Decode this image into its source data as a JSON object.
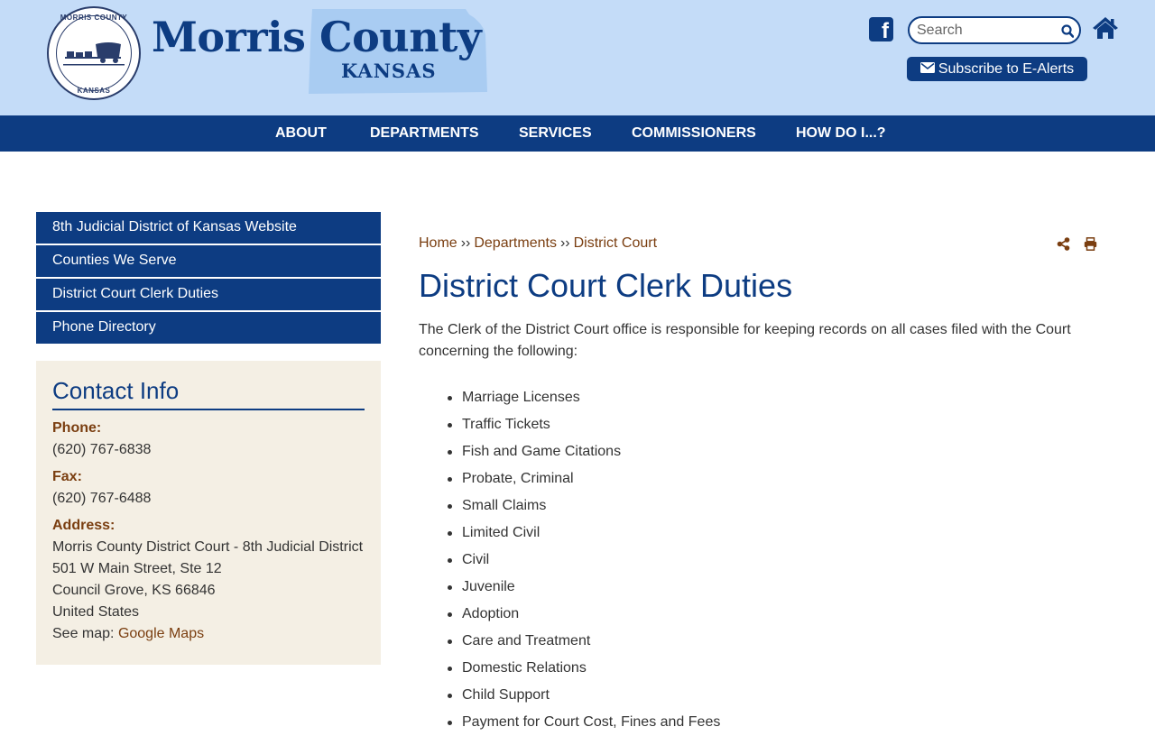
{
  "header": {
    "seal_top_text": "MORRIS COUNTY",
    "seal_bottom_text": "KANSAS",
    "title": "Morris County",
    "subtitle": "KANSAS",
    "search_placeholder": "Search",
    "subscribe_label": "Subscribe to E-Alerts",
    "facebook_glyph": "f"
  },
  "nav": {
    "items": [
      "ABOUT",
      "DEPARTMENTS",
      "SERVICES",
      "COMMISSIONERS",
      "HOW DO I...?"
    ]
  },
  "sidebar": {
    "links": [
      "8th Judicial District of Kansas Website",
      "Counties We Serve",
      "District Court Clerk Duties",
      "Phone Directory"
    ]
  },
  "contact": {
    "heading": "Contact Info",
    "phone_label": "Phone:",
    "phone": "(620) 767-6838",
    "fax_label": "Fax:",
    "fax": "(620) 767-6488",
    "address_label": "Address:",
    "address_lines": [
      "Morris County District Court - 8th Judicial District",
      "501 W Main Street, Ste 12",
      "Council Grove, KS 66846",
      "United States"
    ],
    "map_prefix": "See map:",
    "map_link": "Google Maps"
  },
  "breadcrumb": {
    "items": [
      "Home",
      "Departments",
      "District Court"
    ],
    "separator": "››"
  },
  "main": {
    "title": "District Court Clerk Duties",
    "intro": "The Clerk of the District Court office is responsible for keeping records on all cases filed with the Court concerning the following:",
    "duties": [
      "Marriage Licenses",
      "Traffic Tickets",
      "Fish and Game Citations",
      "Probate, Criminal",
      "Small Claims",
      "Limited Civil",
      "Civil",
      "Juvenile",
      "Adoption",
      "Care and Treatment",
      "Domestic Relations",
      "Child Support",
      "Payment for Court Cost, Fines and Fees"
    ]
  },
  "colors": {
    "header_bg": "#c4dcf8",
    "brand_blue": "#0d3c82",
    "link_brown": "#7a3e10",
    "contact_bg": "#f4efe4"
  },
  "icons": [
    "facebook-icon",
    "search-icon",
    "home-icon",
    "envelope-icon",
    "share-icon",
    "print-icon"
  ]
}
